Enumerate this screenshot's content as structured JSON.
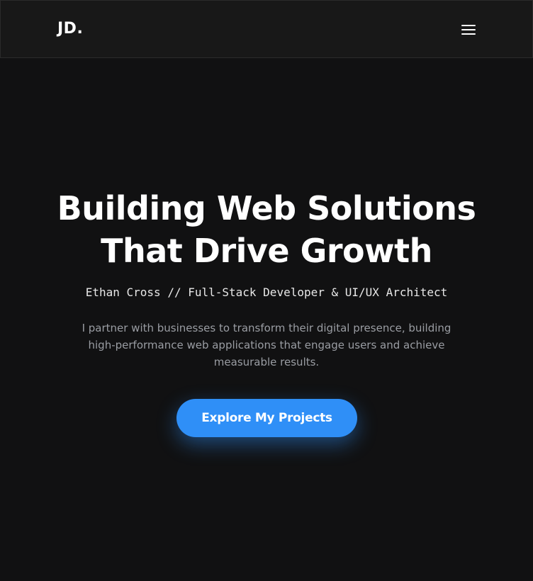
{
  "header": {
    "logo": "JD.",
    "menu_icon": "hamburger-menu-icon"
  },
  "hero": {
    "title_line1": "Building Web Solutions",
    "title_line2": "That Drive Growth",
    "subtitle": "Ethan Cross // Full-Stack Developer & UI/UX Architect",
    "description_line1": "I partner with businesses to transform their digital presence, building",
    "description_line2": "high-performance web applications that engage users and achieve",
    "description_line3": "measurable results.",
    "cta_label": "Explore My Projects"
  },
  "colors": {
    "background": "#111112",
    "header_background": "#181818",
    "accent": "#2f8ff7",
    "text_primary": "#ffffff",
    "text_muted": "#9a9da3"
  }
}
